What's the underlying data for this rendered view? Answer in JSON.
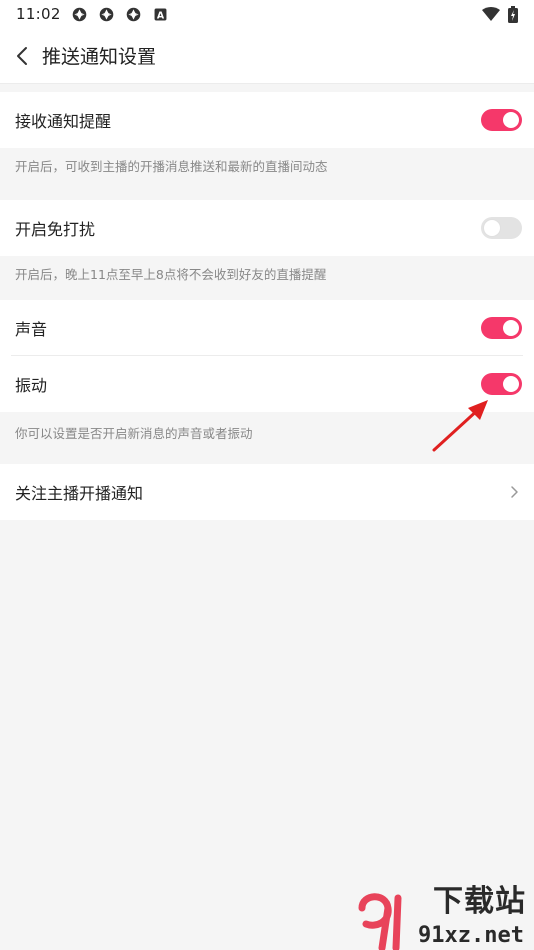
{
  "status_bar": {
    "time": "11:02",
    "notification_icons": [
      "app-notification-icon",
      "app-notification-icon",
      "app-notification-icon",
      "a-badge-icon"
    ],
    "badge_letter": "A"
  },
  "header": {
    "title": "推送通知设置"
  },
  "settings": {
    "receive_notification": {
      "label": "接收通知提醒",
      "enabled": true
    },
    "receive_hint": "开启后，可收到主播的开播消息推送和最新的直播间动态",
    "dnd": {
      "label": "开启免打扰",
      "enabled": false
    },
    "dnd_hint": "开启后，晚上11点至早上8点将不会收到好友的直播提醒",
    "sound": {
      "label": "声音",
      "enabled": true
    },
    "vibration": {
      "label": "振动",
      "enabled": true
    },
    "sound_hint": "你可以设置是否开启新消息的声音或者振动",
    "follow_anchor": {
      "label": "关注主播开播通知"
    }
  },
  "watermark": {
    "top": "下载站",
    "bottom": "91xz.net"
  },
  "colors": {
    "accent": "#f5386a",
    "toggle_off": "#e3e3e3",
    "annotation_arrow": "#e02020"
  }
}
